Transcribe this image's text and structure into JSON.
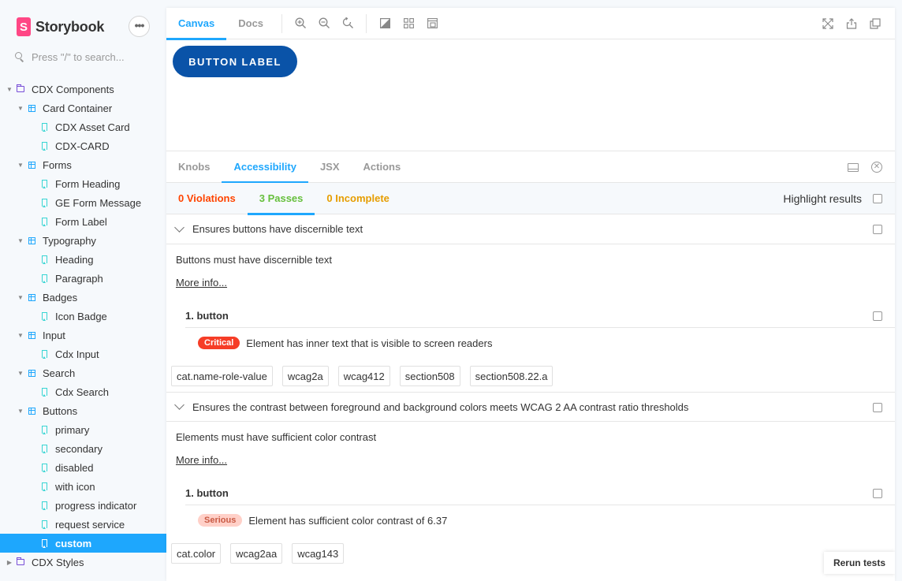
{
  "brand": {
    "logo_letter": "S",
    "name": "Storybook",
    "menu_label": "•••"
  },
  "search": {
    "placeholder": "Press \"/\" to search..."
  },
  "tree": [
    {
      "label": "CDX Components",
      "type": "folder",
      "level": 0,
      "expanded": true
    },
    {
      "label": "Card Container",
      "type": "component",
      "level": 1,
      "expanded": true
    },
    {
      "label": "CDX Asset Card",
      "type": "story",
      "level": 2
    },
    {
      "label": "CDX-CARD",
      "type": "story",
      "level": 2
    },
    {
      "label": "Forms",
      "type": "component",
      "level": 1,
      "expanded": true
    },
    {
      "label": "Form Heading",
      "type": "story",
      "level": 2
    },
    {
      "label": "GE Form Message",
      "type": "story",
      "level": 2
    },
    {
      "label": "Form Label",
      "type": "story",
      "level": 2
    },
    {
      "label": "Typography",
      "type": "component",
      "level": 1,
      "expanded": true
    },
    {
      "label": "Heading",
      "type": "story",
      "level": 2
    },
    {
      "label": "Paragraph",
      "type": "story",
      "level": 2
    },
    {
      "label": "Badges",
      "type": "component",
      "level": 1,
      "expanded": true
    },
    {
      "label": "Icon Badge",
      "type": "story",
      "level": 2
    },
    {
      "label": "Input",
      "type": "component",
      "level": 1,
      "expanded": true
    },
    {
      "label": "Cdx Input",
      "type": "story",
      "level": 2
    },
    {
      "label": "Search",
      "type": "component",
      "level": 1,
      "expanded": true
    },
    {
      "label": "Cdx Search",
      "type": "story",
      "level": 2
    },
    {
      "label": "Buttons",
      "type": "component",
      "level": 1,
      "expanded": true
    },
    {
      "label": "primary",
      "type": "story",
      "level": 2
    },
    {
      "label": "secondary",
      "type": "story",
      "level": 2
    },
    {
      "label": "disabled",
      "type": "story",
      "level": 2
    },
    {
      "label": "with icon",
      "type": "story",
      "level": 2
    },
    {
      "label": "progress indicator",
      "type": "story",
      "level": 2
    },
    {
      "label": "request service",
      "type": "story",
      "level": 2
    },
    {
      "label": "custom",
      "type": "story",
      "level": 2,
      "selected": true
    },
    {
      "label": "CDX Styles",
      "type": "folder",
      "level": 0,
      "expanded": false
    }
  ],
  "toolbar": {
    "tabs": [
      "Canvas",
      "Docs"
    ],
    "active_tab": "Canvas",
    "tools": [
      "zoom-in-icon",
      "zoom-out-icon",
      "zoom-reset-icon",
      "background-icon",
      "grid-icon",
      "viewport-icon"
    ],
    "right_tools": [
      "fullscreen-icon",
      "share-icon",
      "copy-link-icon"
    ]
  },
  "canvas": {
    "button_label": "BUTTON LABEL",
    "button_color": "#0a53a8"
  },
  "addons": {
    "tabs": [
      "Knobs",
      "Accessibility",
      "JSX",
      "Actions"
    ],
    "active_tab": "Accessibility"
  },
  "a11y": {
    "violations_label": "0 Violations",
    "passes_label": "3 Passes",
    "incomplete_label": "0 Incomplete",
    "highlight_label": "Highlight results",
    "rules": [
      {
        "title": "Ensures buttons have discernible text",
        "description": "Buttons must have discernible text",
        "more_info": "More info...",
        "node_label": "1. button",
        "impact": "Critical",
        "finding": "Element has inner text that is visible to screen readers",
        "tags": [
          "cat.name-role-value",
          "wcag2a",
          "wcag412",
          "section508",
          "section508.22.a"
        ]
      },
      {
        "title": "Ensures the contrast between foreground and background colors meets WCAG 2 AA contrast ratio thresholds",
        "description": "Elements must have sufficient color contrast",
        "more_info": "More info...",
        "node_label": "1. button",
        "impact": "Serious",
        "finding": "Element has sufficient color contrast of 6.37",
        "tags": [
          "cat.color",
          "wcag2aa",
          "wcag143"
        ]
      }
    ],
    "rerun_label": "Rerun tests"
  },
  "colors": {
    "accent": "#1ea7fd",
    "violations": "#ff4400",
    "passes": "#66bf3c",
    "incomplete": "#e69d00",
    "brand": "#ff4785"
  }
}
